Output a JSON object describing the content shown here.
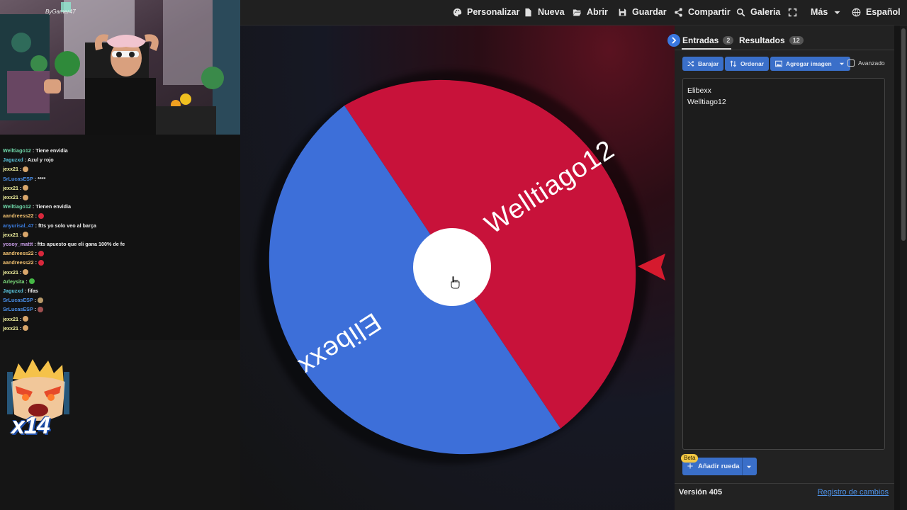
{
  "toolbar": {
    "items": [
      {
        "label": "Personalizar",
        "icon": "palette-icon"
      },
      {
        "label": "Nueva",
        "icon": "file-icon"
      },
      {
        "label": "Abrir",
        "icon": "folder-open-icon"
      },
      {
        "label": "Guardar",
        "icon": "save-icon"
      },
      {
        "label": "Compartir",
        "icon": "share-icon"
      },
      {
        "label": "Galeria",
        "icon": "search-icon"
      },
      {
        "label": "",
        "icon": "fullscreen-icon"
      },
      {
        "label": "Más",
        "icon": "caret-down-icon"
      },
      {
        "label": "Español",
        "icon": "globe-icon"
      }
    ]
  },
  "wheel": {
    "segments": [
      {
        "label": "Welltiago12",
        "color": "#c8123a"
      },
      {
        "label": "Elibexx",
        "color": "#3d6fd9"
      }
    ],
    "pointer_color": "#d51a2e",
    "center_color": "#ffffff"
  },
  "panel": {
    "tabs": [
      {
        "label": "Entradas",
        "count": "2"
      },
      {
        "label": "Resultados",
        "count": "12"
      }
    ],
    "actions": {
      "shuffle": "Barajar",
      "sort": "Ordenar",
      "add_image": "Agregar imagen",
      "advanced": "Avanzado"
    },
    "entries": [
      "Elibexx",
      "Welltiago12"
    ],
    "beta_badge": "Beta",
    "add_wheel": "Añadir rueda",
    "version": "Versión 405",
    "changelog": "Registro de cambios"
  },
  "stream": {
    "chat": [
      {
        "user": "Welltiago12",
        "msg": ": Tiene envidia",
        "color": "#6fd6a8",
        "emote": ""
      },
      {
        "user": "Jaguzxd",
        "msg": ": Azul y rojo",
        "color": "#5cc8e0",
        "emote": ""
      },
      {
        "user": "jexx21",
        "msg": ":",
        "color": "#f3f3a0",
        "emote": "#d9a66b"
      },
      {
        "user": "SrLucasESP",
        "msg": ": ****",
        "color": "#4a8fe8",
        "emote": ""
      },
      {
        "user": "jexx21",
        "msg": ":",
        "color": "#f3f3a0",
        "emote": "#d9a66b"
      },
      {
        "user": "jexx21",
        "msg": ":",
        "color": "#f3f3a0",
        "emote": "#d9a66b"
      },
      {
        "user": "Welltiago12",
        "msg": ": Tienen envidia",
        "color": "#6fd6a8",
        "emote": ""
      },
      {
        "user": "aandreess22",
        "msg": ":",
        "color": "#f0c070",
        "emote": "#d8283c"
      },
      {
        "user": "anyurisal_47",
        "msg": ": ftts yo solo veo al barça",
        "color": "#3b7de0",
        "emote": ""
      },
      {
        "user": "jexx21",
        "msg": ":",
        "color": "#f3f3a0",
        "emote": "#d9a66b"
      },
      {
        "user": "yosoy_mattt",
        "msg": ": ftts apuesto que eli gana 100% de fe",
        "color": "#c99ee8",
        "emote": ""
      },
      {
        "user": "aandreess22",
        "msg": ":",
        "color": "#f0c070",
        "emote": "#d8283c"
      },
      {
        "user": "aandreess22",
        "msg": ":",
        "color": "#f0c070",
        "emote": "#d8283c"
      },
      {
        "user": "jexx21",
        "msg": ":",
        "color": "#f3f3a0",
        "emote": "#d9a66b"
      },
      {
        "user": "Arleysita",
        "msg": ":",
        "color": "#7ee07e",
        "emote": "#45b845"
      },
      {
        "user": "Jaguzxd",
        "msg": ": fifas",
        "color": "#5cc8e0",
        "emote": ""
      },
      {
        "user": "SrLucasESP",
        "msg": ":",
        "color": "#4a8fe8",
        "emote": "#b89a6a"
      },
      {
        "user": "SrLucasESP",
        "msg": ":",
        "color": "#4a8fe8",
        "emote": "#a05050"
      },
      {
        "user": "jexx21",
        "msg": ":",
        "color": "#f3f3a0",
        "emote": "#d9a66b"
      },
      {
        "user": "jexx21",
        "msg": ":",
        "color": "#f3f3a0",
        "emote": "#d9a66b"
      }
    ],
    "cam_tag": "ByGamer47",
    "multiplier": "x14"
  }
}
